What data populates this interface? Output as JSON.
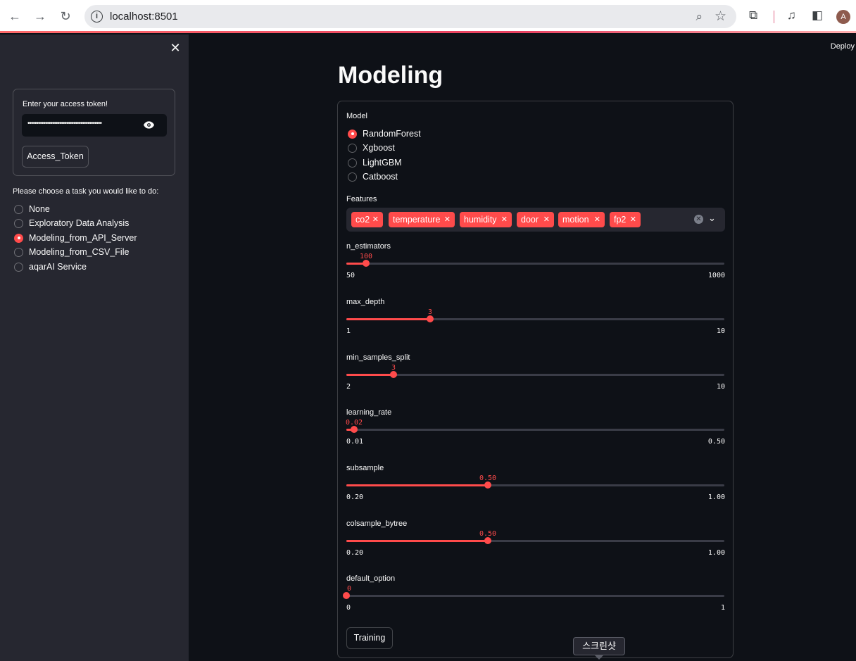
{
  "browser": {
    "url": "localhost:8501",
    "avatar_initial": "A"
  },
  "sidebar": {
    "token_label": "Enter your access token!",
    "token_value": "••••••••••••••••••••••••••••••••••••••••••",
    "token_button": "Access_Token",
    "task_label": "Please choose a task you would like to do:",
    "tasks": [
      {
        "label": "None",
        "selected": false
      },
      {
        "label": "Exploratory Data Analysis",
        "selected": false
      },
      {
        "label": "Modeling_from_API_Server",
        "selected": true
      },
      {
        "label": "Modeling_from_CSV_File",
        "selected": false
      },
      {
        "label": "aqarAI Service",
        "selected": false
      }
    ]
  },
  "header": {
    "deploy_label": "Deploy"
  },
  "main": {
    "title": "Modeling",
    "model_label": "Model",
    "models": [
      {
        "label": "RandomForest",
        "selected": true
      },
      {
        "label": "Xgboost",
        "selected": false
      },
      {
        "label": "LightGBM",
        "selected": false
      },
      {
        "label": "Catboost",
        "selected": false
      }
    ],
    "features_label": "Features",
    "features": [
      "co2",
      "temperature",
      "humidity",
      "door",
      "motion",
      "fp2"
    ],
    "sliders": [
      {
        "label": "n_estimators",
        "value": "100",
        "min": "50",
        "max": "1000",
        "fraction": 0.0526
      },
      {
        "label": "max_depth",
        "value": "3",
        "min": "1",
        "max": "10",
        "fraction": 0.2222
      },
      {
        "label": "min_samples_split",
        "value": "3",
        "min": "2",
        "max": "10",
        "fraction": 0.125
      },
      {
        "label": "learning_rate",
        "value": "0.02",
        "min": "0.01",
        "max": "0.50",
        "fraction": 0.0204
      },
      {
        "label": "subsample",
        "value": "0.50",
        "min": "0.20",
        "max": "1.00",
        "fraction": 0.375
      },
      {
        "label": "colsample_bytree",
        "value": "0.50",
        "min": "0.20",
        "max": "1.00",
        "fraction": 0.375
      },
      {
        "label": "default_option",
        "value": "0",
        "min": "0",
        "max": "1",
        "fraction": 0.0
      }
    ],
    "train_button": "Training"
  },
  "tooltip": {
    "text": "스크린샷"
  },
  "colors": {
    "accent": "#ff4b4b",
    "background": "#0e1117",
    "sidebar": "#262730"
  }
}
